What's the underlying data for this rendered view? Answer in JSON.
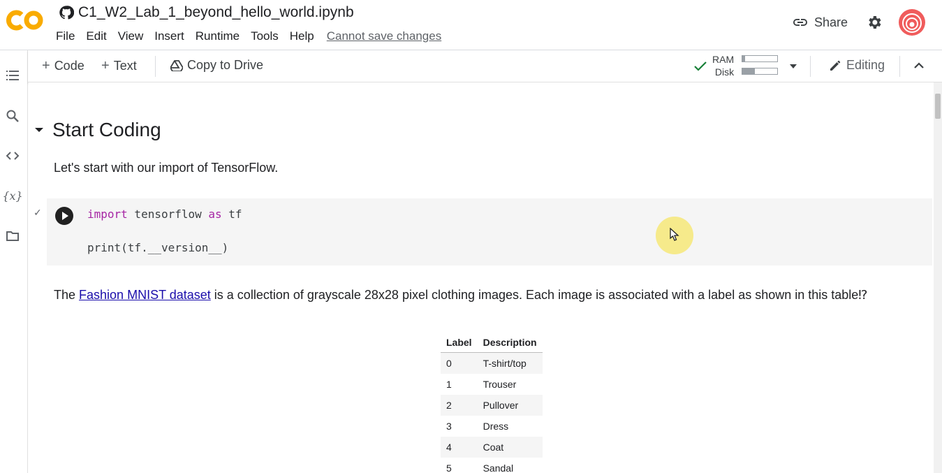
{
  "app": {
    "notebook_title": "C1_W2_Lab_1_beyond_hello_world.ipynb",
    "logo_text": "CO",
    "brand_color": "#f9ab00"
  },
  "menu": {
    "items": [
      "File",
      "Edit",
      "View",
      "Insert",
      "Runtime",
      "Tools",
      "Help"
    ],
    "status_link": "Cannot save changes"
  },
  "header_actions": {
    "share_label": "Share",
    "share_icon": "link-icon",
    "settings_icon": "gear-icon",
    "avatar_icon": "user-avatar"
  },
  "toolbar": {
    "add_code_label": "Code",
    "add_text_label": "Text",
    "copy_to_drive_label": "Copy to Drive",
    "ram_label": "RAM",
    "disk_label": "Disk",
    "ram_usage": 0.08,
    "disk_usage": 0.35,
    "editing_label": "Editing"
  },
  "sidebar": {
    "icons": [
      "table-of-contents-icon",
      "search-icon",
      "code-snippets-icon",
      "variables-icon",
      "files-icon"
    ]
  },
  "notebook": {
    "section_title": "Start Coding",
    "intro_text": "Let's start with our import of TensorFlow.",
    "code_line_1": {
      "keyword1": "import",
      "rest1": " tensorflow ",
      "keyword2": "as",
      "rest2": " tf"
    },
    "code_line_2": "print(tf.__version__)",
    "para_before_link": "The ",
    "link_text": "Fashion MNIST dataset",
    "para_after_link": " is a collection of grayscale 28x28 pixel clothing images. Each image is associated with a label as shown in this table⁉",
    "table": {
      "headers": [
        "Label",
        "Description"
      ],
      "rows": [
        [
          "0",
          "T-shirt/top"
        ],
        [
          "1",
          "Trouser"
        ],
        [
          "2",
          "Pullover"
        ],
        [
          "3",
          "Dress"
        ],
        [
          "4",
          "Coat"
        ],
        [
          "5",
          "Sandal"
        ]
      ]
    }
  }
}
